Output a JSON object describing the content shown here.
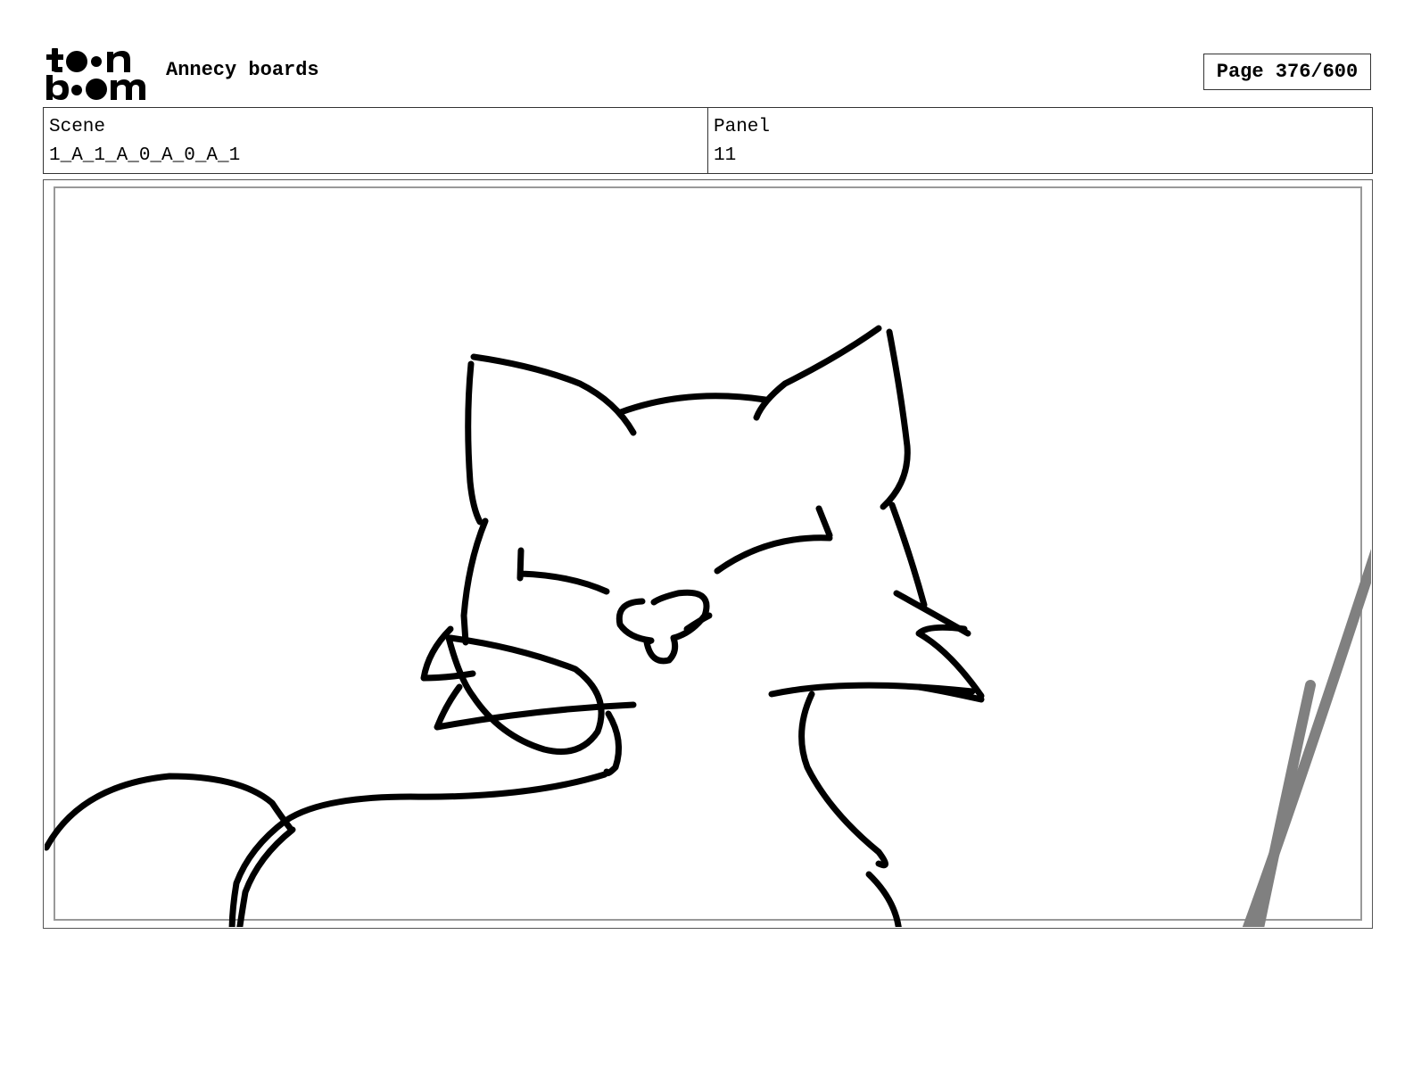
{
  "header": {
    "logo_top": "toon",
    "logo_bottom": "boom",
    "title": "Annecy boards",
    "page": "Page 376/600"
  },
  "info": {
    "scene_label": "Scene",
    "scene_value": "1_A_1_A_0_A_0_A_1",
    "panel_label": "Panel",
    "panel_value": "11"
  },
  "panel": {
    "content": "cat-sketch",
    "stroke_color": "#000000",
    "secondary_stroke_color": "#808080"
  }
}
